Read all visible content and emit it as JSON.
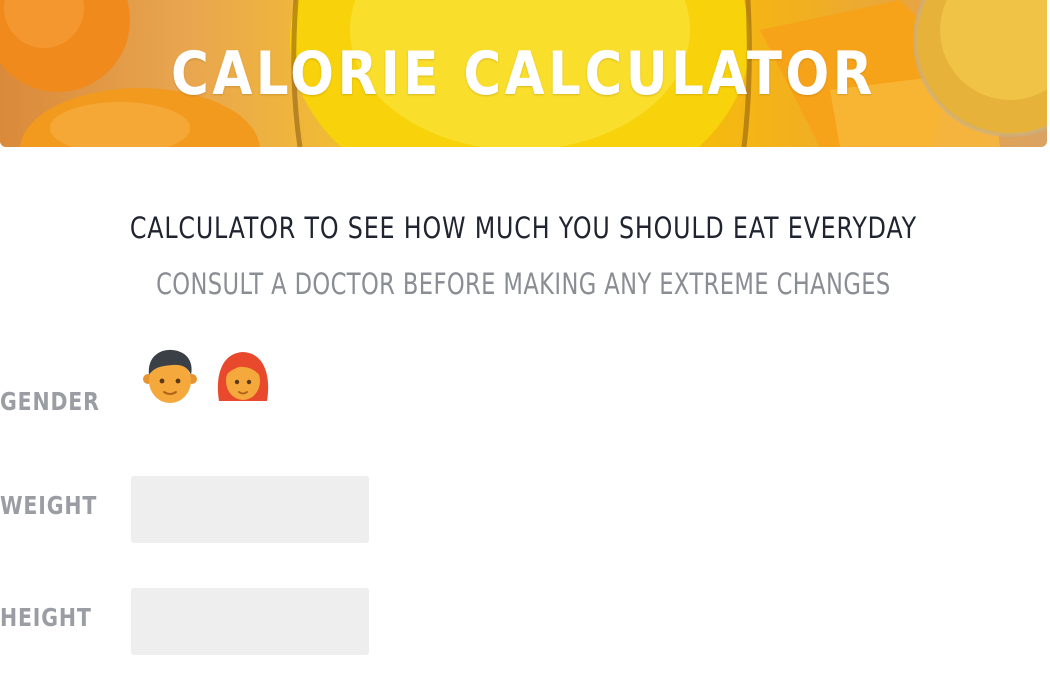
{
  "header": {
    "title": "CALORIE CALCULATOR"
  },
  "intro": {
    "heading": "CALCULATOR TO SEE HOW MUCH YOU SHOULD EAT EVERYDAY",
    "subheading": "CONSULT A DOCTOR BEFORE MAKING ANY EXTREME CHANGES"
  },
  "form": {
    "gender": {
      "label": "GENDER",
      "options": [
        {
          "icon": "man-face-icon"
        },
        {
          "icon": "woman-face-icon"
        }
      ]
    },
    "weight": {
      "label": "WEIGHT",
      "value": "",
      "placeholder": ""
    },
    "height": {
      "label": "HEIGHT",
      "value": "",
      "placeholder": ""
    }
  },
  "colors": {
    "banner_yellow": "#f6c400",
    "banner_orange": "#e9a650",
    "heading_text": "#1f2430",
    "muted_text": "#8a8d93",
    "label_text": "#9a9da3",
    "input_background": "#eeeeee",
    "male_hair": "#3b3f46",
    "female_hair": "#e8492c",
    "skin": "#f5a83b"
  }
}
